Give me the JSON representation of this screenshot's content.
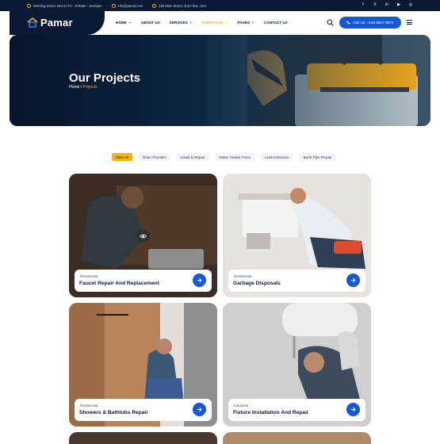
{
  "topbar": {
    "hours": "Working Hours: Mon to Fri - 8:00am - 16:00pm",
    "email": "info@pamar.com",
    "address": "156 Main Street, 2nd Floor, USA",
    "socials": [
      "f",
      "X",
      "in",
      "▶",
      "◎"
    ]
  },
  "brand": {
    "name": "Pamar"
  },
  "nav": {
    "items": [
      {
        "label": "HOME",
        "caret": "⌄"
      },
      {
        "label": "ABOUT US",
        "caret": ""
      },
      {
        "label": "SERVICES",
        "caret": "⌄"
      },
      {
        "label": "PORTFOLIO",
        "caret": "⌄"
      },
      {
        "label": "PAGES",
        "caret": "⌄"
      },
      {
        "label": "CONTACT US",
        "caret": ""
      }
    ],
    "call_label": "Call Us: +163-6547-9874"
  },
  "hero": {
    "title": "Our Projects",
    "breadcrumb_home": "Home",
    "breadcrumb_sep": "/",
    "breadcrumb_current": "Projects"
  },
  "filters": [
    "View All",
    "Drain Plumber",
    "Install & Repair",
    "Water Heater Fixes",
    "Leak Detection",
    "Burst Pipe Repair"
  ],
  "projects": [
    {
      "category": "Residential",
      "title": "Faucet Repair And Replacement"
    },
    {
      "category": "Residential",
      "title": "Garbage Disposals"
    },
    {
      "category": "Residential",
      "title": "Showers & Bathtubs Repair"
    },
    {
      "category": "Industrial",
      "title": "Fixture Installation And Repair"
    }
  ],
  "colors": {
    "navy": "#0b1a33",
    "accent": "#f5b21b",
    "primary": "#1457d9"
  },
  "icons": {
    "topbar": [
      "clock-icon",
      "mail-icon",
      "location-icon"
    ],
    "header": [
      "house-logo-icon",
      "search-icon",
      "phone-icon",
      "hamburger-menu-icon"
    ],
    "cards": [
      "arrow-right-icon",
      "eye-icon"
    ]
  }
}
